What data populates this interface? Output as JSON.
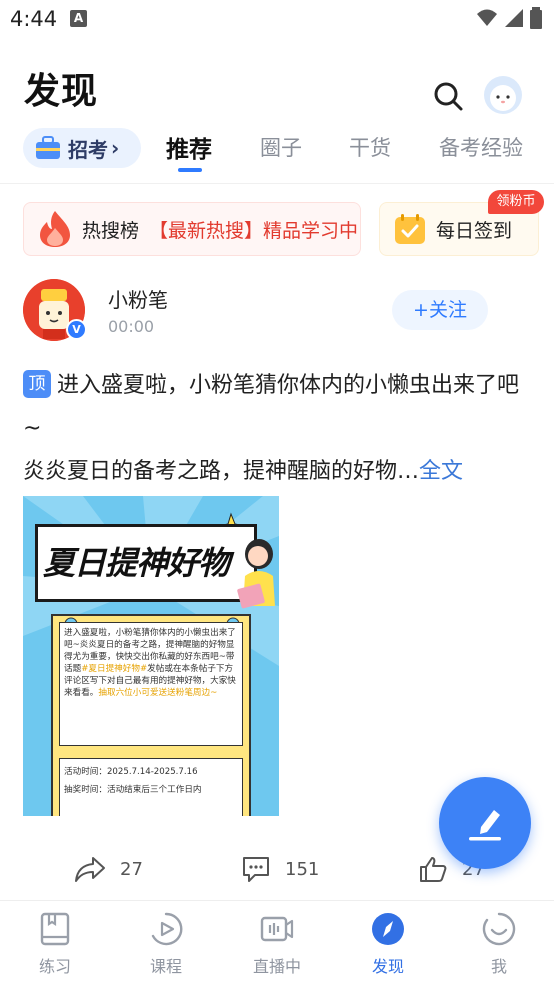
{
  "status_bar": {
    "time": "4:44",
    "sim_letter": "A"
  },
  "header": {
    "title": "发现"
  },
  "tabs": {
    "zhaokao": "招考",
    "items": [
      "推荐",
      "圈子",
      "干货",
      "备考经验"
    ],
    "active": "推荐"
  },
  "banners": {
    "hot_search": {
      "name": "热搜榜",
      "promo": "【最新热搜】精品学习中"
    },
    "sign_in": {
      "name": "每日签到",
      "badge": "领粉币"
    }
  },
  "post": {
    "author": "小粉笔",
    "time": "00:00",
    "follow_label": "+关注",
    "verified_glyph": "V",
    "pin_label": "顶",
    "text_line1": "进入盛夏啦，小粉笔猜你体内的小懒虫出来了吧~",
    "text_line2": "炎炎夏日的备考之路，提神醒脑的好物…",
    "more_label": "全文",
    "image": {
      "headline": "夏日提神好物",
      "body_a": "进入盛夏啦，小粉笔猜你体内的小懒虫出来了吧~炎炎夏日的备考之路，提神醒脑的好物显得尤为重要，快快交出你私藏的好东西吧~带话题",
      "body_hl1": "#夏日提神好物#",
      "body_b": "发帖或在本条帖子下方评论区写下对自己最有用的提神好物，大家快来看看。",
      "body_hl2": "抽取六位小可爱送送粉笔周边~",
      "activity_time": "活动时间：2025.7.14-2025.7.16",
      "draw_time": "抽奖时间：活动结束后三个工作日内"
    },
    "actions": {
      "share": "27",
      "comments": "151",
      "likes": "27"
    }
  },
  "nav": {
    "items": [
      {
        "label": "练习",
        "icon": "book-icon"
      },
      {
        "label": "课程",
        "icon": "play-icon"
      },
      {
        "label": "直播中",
        "icon": "live-icon"
      },
      {
        "label": "发现",
        "icon": "compass-icon"
      },
      {
        "label": "我",
        "icon": "smile-icon"
      }
    ],
    "active": "发现"
  },
  "colors": {
    "accent": "#2f7bff",
    "hot_red": "#e23a2e",
    "nav_active": "#3270e4",
    "fab": "#3d82f6"
  }
}
